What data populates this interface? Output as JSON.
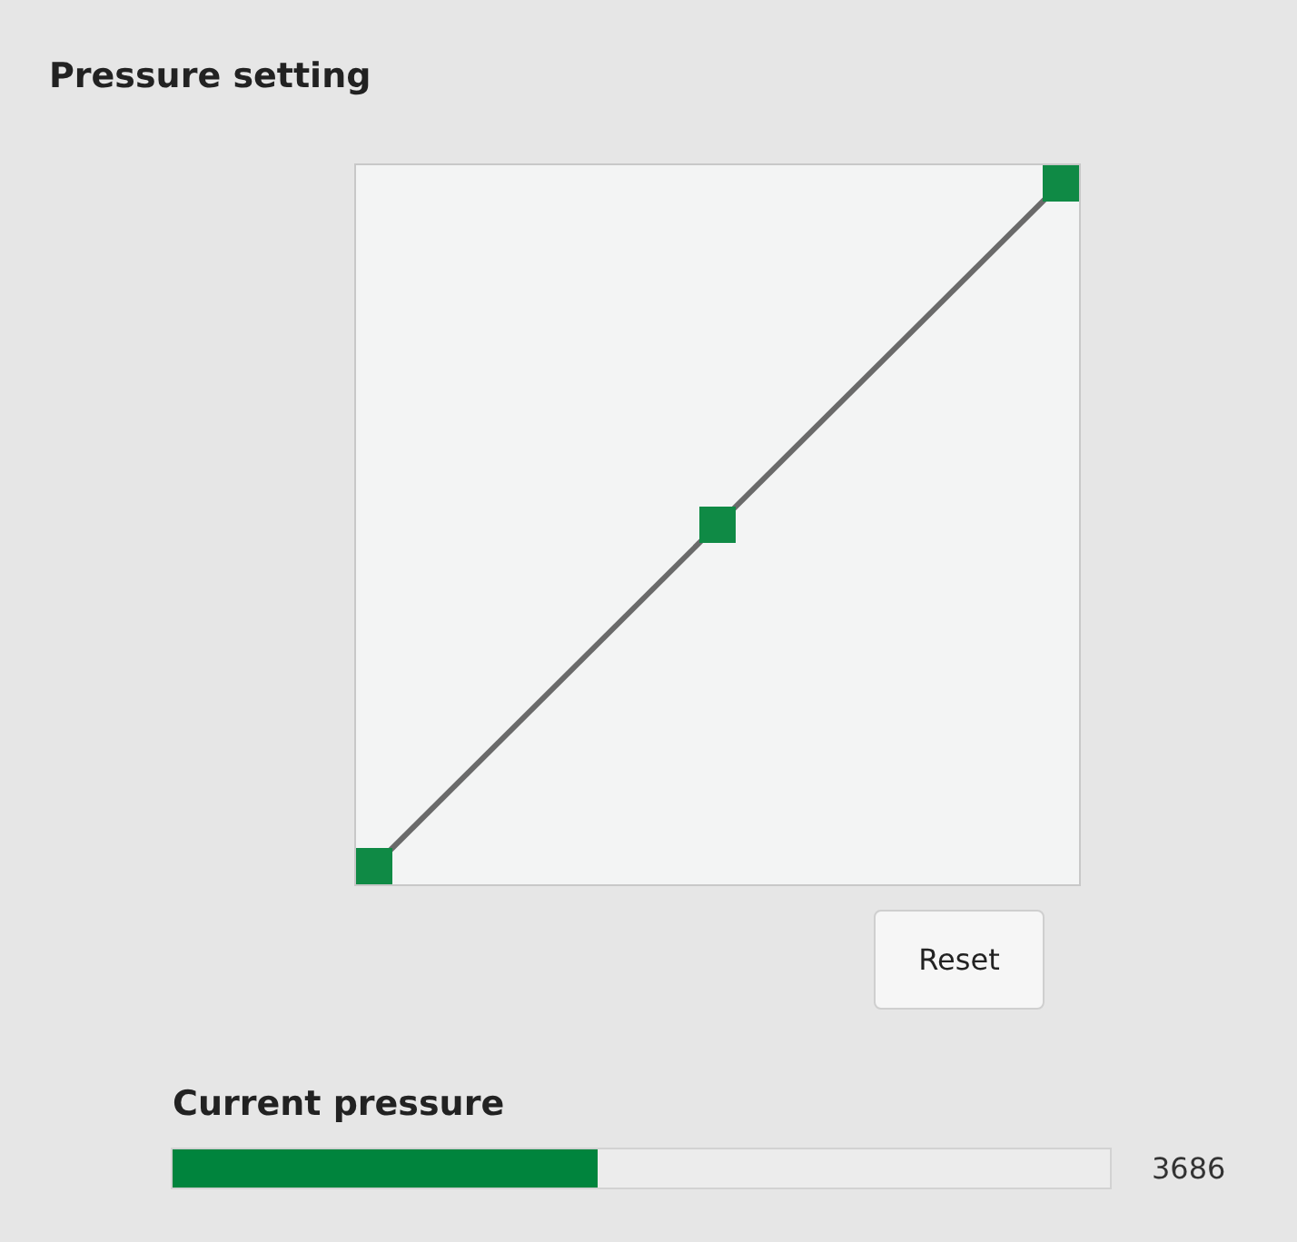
{
  "title": "Pressure setting",
  "reset_button": "Reset",
  "current_pressure": {
    "label": "Current pressure",
    "level": 0.454,
    "reading": "3686"
  }
}
